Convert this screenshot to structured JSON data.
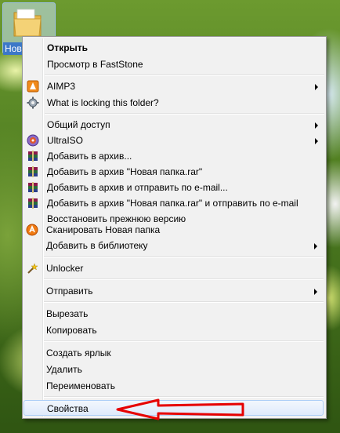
{
  "desktop": {
    "folder_label": "Новая папка"
  },
  "context_menu": {
    "open": "Открыть",
    "view_faststone": "Просмотр в FastStone",
    "aimp3": "AIMP3",
    "what_locking": "What is locking this folder?",
    "sharing": "Общий доступ",
    "ultraiso": "UltraISO",
    "add_archive": "Добавить в архив...",
    "add_archive_rar": "Добавить в архив \"Новая папка.rar\"",
    "add_archive_email": "Добавить в архив и отправить по e-mail...",
    "add_archive_rar_email": "Добавить в архив \"Новая папка.rar\" и отправить по e-mail",
    "restore_version": "Восстановить прежнюю версию",
    "scan": "Сканировать Новая папка",
    "add_library": "Добавить в библиотеку",
    "unlocker": "Unlocker",
    "send_to": "Отправить",
    "cut": "Вырезать",
    "copy": "Копировать",
    "create_shortcut": "Создать ярлык",
    "delete": "Удалить",
    "rename": "Переименовать",
    "properties": "Свойства"
  },
  "colors": {
    "highlight_border": "#aecff7",
    "annotation_arrow": "#e60000"
  },
  "icons": {
    "aimp3": "aimp-icon",
    "what_locking": "gear-icon",
    "ultraiso": "ultraiso-disc-icon",
    "winrar": "winrar-books-icon",
    "scan": "avast-icon",
    "unlocker": "wand-icon"
  }
}
